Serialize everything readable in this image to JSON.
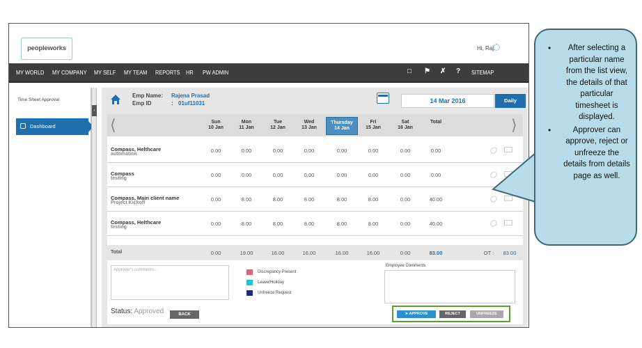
{
  "app": {
    "logo_text": "peopleworks",
    "greeting": "Hi, Raj"
  },
  "nav": {
    "items": [
      "MY WORLD",
      "MY COMPANY",
      "MY SELF",
      "MY TEAM",
      "REPORTS",
      "HR",
      "PW ADMIN"
    ],
    "icons": [
      "book-icon",
      "flag-icon",
      "tools-icon",
      "help-icon"
    ],
    "sitemap": "SITEMAP"
  },
  "sidebar": {
    "heading": "Time Sheet Approval",
    "active_item": "Dashboard"
  },
  "employee": {
    "name_label": "Emp Name:",
    "name": "Rajena Prasad",
    "id_label": "Emp ID",
    "id_sep": ":",
    "id": "01uf11031"
  },
  "date": {
    "value": "14 Mar 2016",
    "view_button": "Daily"
  },
  "days": [
    {
      "day": "Sun",
      "date": "10 Jan"
    },
    {
      "day": "Mon",
      "date": "11 Jan"
    },
    {
      "day": "Tue",
      "date": "12 Jan"
    },
    {
      "day": "Wed",
      "date": "13 Jan"
    },
    {
      "day": "Thursday",
      "date": "14 Jan"
    },
    {
      "day": "Fri",
      "date": "15 Jan"
    },
    {
      "day": "Sat",
      "date": "16 Jan"
    }
  ],
  "total_header": "Total",
  "rows": [
    {
      "project": "Compass, Helthcare",
      "task": "automation",
      "values": [
        "0.00",
        "0.00",
        "0.00",
        "0.00",
        "0.00",
        "0.00",
        "0.00",
        "0.00"
      ]
    },
    {
      "project": "Compass",
      "task": "testing",
      "values": [
        "0.00",
        "0.00",
        "0.00",
        "0.00",
        "0.00",
        "0.00",
        "0.00",
        "0.00"
      ]
    },
    {
      "project": "Compass, Main client name",
      "task": "Project Kickoff",
      "values": [
        "0.00",
        "8.00",
        "8.00",
        "8.00",
        "8.00",
        "8.00",
        "0.00",
        "40.00"
      ]
    },
    {
      "project": "Compass, Helthcare",
      "task": "testing",
      "values": [
        "0.00",
        "8.00",
        "8.00",
        "8.00",
        "8.00",
        "8.00",
        "0.00",
        "40.00"
      ]
    }
  ],
  "totals": {
    "label": "Total",
    "values": [
      "0.00",
      "19.00",
      "16.00",
      "16.00",
      "16.00",
      "16.00",
      "0.00",
      "83.00"
    ],
    "ot_label": "OT :",
    "ot_value": "83.00"
  },
  "comments": {
    "approver_placeholder": "Approver's comments...",
    "employee_label": "Employee Comments"
  },
  "legend": [
    {
      "label": "Discrepancy Present",
      "color": "#d9667a"
    },
    {
      "label": "Leave/Holiday",
      "color": "#22c4cc"
    },
    {
      "label": "Unfreeze Request",
      "color": "#1f2a7a"
    }
  ],
  "status": {
    "label": "Status:",
    "value": "Approved"
  },
  "buttons": {
    "back": "BACK",
    "approve": "APPROVE",
    "reject": "REJECT",
    "unfreeze": "UNFREEZE"
  },
  "callout": {
    "bullets": [
      "After selecting a particular name from the list view, the details of that particular timesheet is displayed.",
      "Approver can approve, reject or unfreeze the details from details page as well."
    ]
  }
}
